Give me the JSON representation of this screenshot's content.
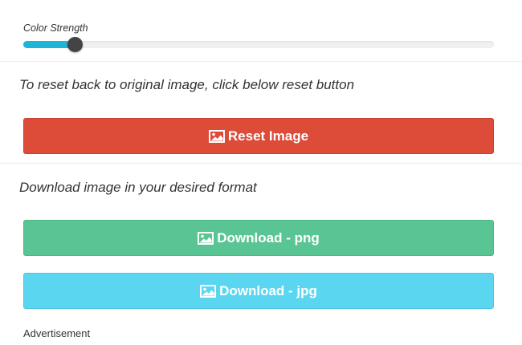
{
  "slider": {
    "label": "Color Strength",
    "value_fraction": 0.111,
    "fill_color": "#1fb5d9",
    "thumb_color": "#444444"
  },
  "reset_section": {
    "instruction": "To reset back to original image, click below reset button",
    "button_label": "Reset Image",
    "button_icon": "image-icon",
    "button_color": "#dd4b39"
  },
  "download_section": {
    "instruction": "Download image in your desired format",
    "png_label": "Download - png",
    "png_icon": "image-icon",
    "png_color": "#5ac594",
    "jpg_label": "Download - jpg",
    "jpg_icon": "image-icon",
    "jpg_color": "#5bd6f1"
  },
  "advertisement": {
    "label": "Advertisement"
  }
}
